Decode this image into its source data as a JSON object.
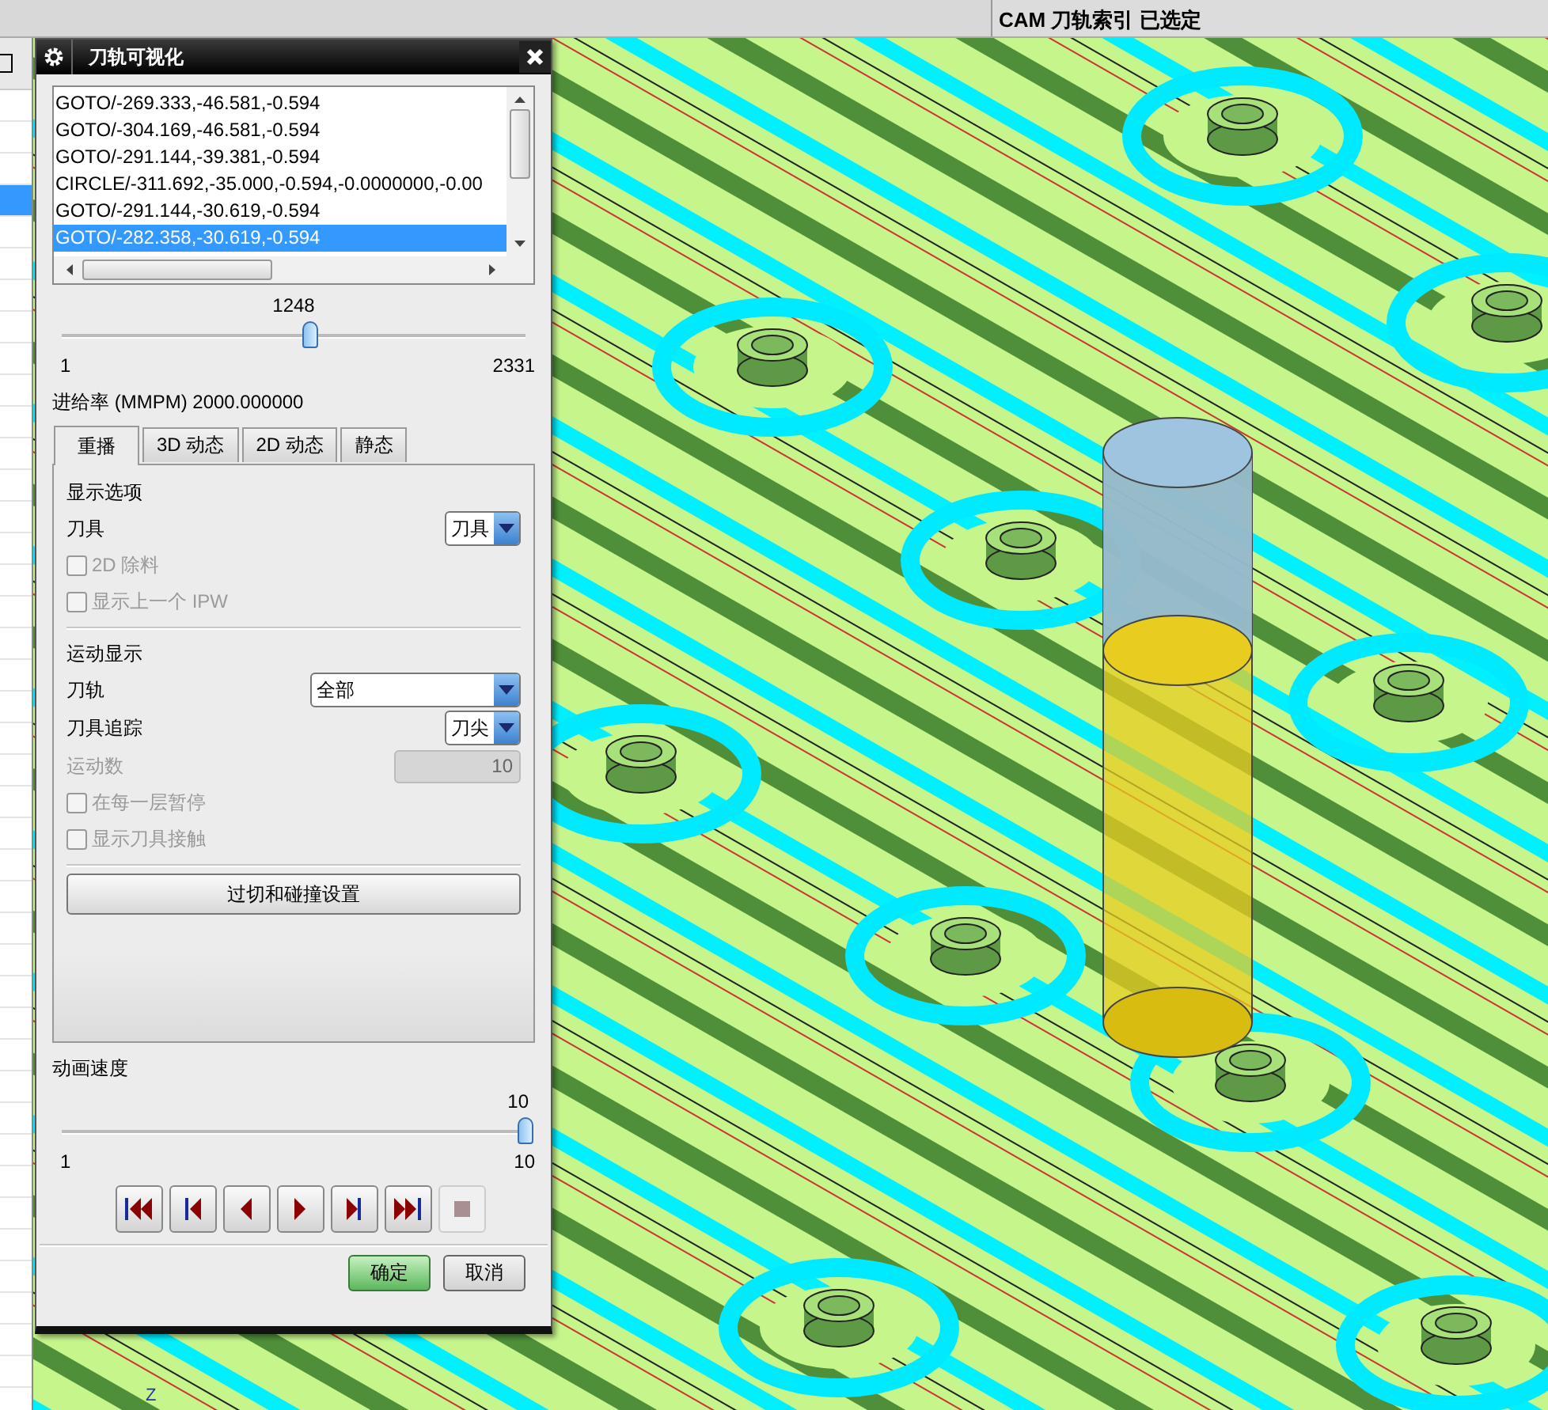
{
  "status_bar": {
    "message": "CAM 刀轨索引 已选定"
  },
  "side_list": {
    "rows": [
      {
        "selected": false
      },
      {
        "selected": false
      },
      {
        "selected": false
      },
      {
        "selected": true
      },
      {
        "selected": false
      },
      {
        "selected": false
      },
      {
        "selected": false
      },
      {
        "selected": false
      },
      {
        "selected": false
      },
      {
        "selected": false
      },
      {
        "selected": false
      },
      {
        "selected": false
      },
      {
        "selected": false
      },
      {
        "selected": false
      },
      {
        "selected": false
      },
      {
        "selected": false
      },
      {
        "selected": false
      },
      {
        "selected": false
      },
      {
        "selected": false
      },
      {
        "selected": false
      },
      {
        "selected": false
      },
      {
        "selected": false
      },
      {
        "selected": false
      },
      {
        "selected": false
      },
      {
        "selected": false
      },
      {
        "selected": false
      },
      {
        "selected": false
      },
      {
        "selected": false
      },
      {
        "selected": false
      },
      {
        "selected": false
      },
      {
        "selected": false
      },
      {
        "selected": false
      },
      {
        "selected": false
      },
      {
        "selected": false
      },
      {
        "selected": false
      },
      {
        "selected": false
      },
      {
        "selected": false
      },
      {
        "selected": false
      },
      {
        "selected": false
      },
      {
        "selected": false
      },
      {
        "selected": false
      }
    ]
  },
  "dialog": {
    "title": "刀轨可视化",
    "path_list": {
      "rows": [
        {
          "text": "GOTO/-269.333,-46.581,-0.594",
          "selected": false
        },
        {
          "text": "GOTO/-304.169,-46.581,-0.594",
          "selected": false
        },
        {
          "text": "GOTO/-291.144,-39.381,-0.594",
          "selected": false
        },
        {
          "text": "CIRCLE/-311.692,-35.000,-0.594,-0.0000000,-0.00",
          "selected": false
        },
        {
          "text": "GOTO/-291.144,-30.619,-0.594",
          "selected": false
        },
        {
          "text": "GOTO/-282.358,-30.619,-0.594",
          "selected": true
        }
      ]
    },
    "position_slider": {
      "value": "1248",
      "min": "1",
      "max": "2331",
      "level": 0.535
    },
    "feed_rate": "进给率 (MMPM) 2000.000000",
    "tabs": [
      {
        "label": "重播",
        "selected": true
      },
      {
        "label": "3D 动态",
        "selected": false
      },
      {
        "label": "2D 动态",
        "selected": false
      },
      {
        "label": "静态",
        "selected": false
      }
    ],
    "options": [
      {
        "kind": "heading",
        "label": "显示选项"
      },
      {
        "kind": "dropdown",
        "label": "刀具",
        "value": "刀具"
      },
      {
        "kind": "checkbox",
        "label": "2D 除料",
        "checked": false,
        "disabled": true
      },
      {
        "kind": "checkbox",
        "label": "显示上一个 IPW",
        "checked": false,
        "disabled": true
      },
      {
        "kind": "heading",
        "label": "运动显示"
      },
      {
        "kind": "combo",
        "label": "刀轨",
        "value": "全部"
      },
      {
        "kind": "dropdown",
        "label": "刀具追踪",
        "value": "刀尖"
      },
      {
        "kind": "number",
        "label": "运动数",
        "value": "10",
        "disabled": true
      },
      {
        "kind": "checkbox",
        "label": "在每一层暂停",
        "checked": false,
        "disabled": true
      },
      {
        "kind": "checkbox",
        "label": "显示刀具接触",
        "checked": false,
        "disabled": true
      },
      {
        "kind": "button",
        "label": "过切和碰撞设置"
      }
    ],
    "speed_slider": {
      "label": "动画速度",
      "value": "10",
      "min": "1",
      "max": "10",
      "level": 1
    },
    "playback_buttons": [
      {
        "kind": "first",
        "disabled": false
      },
      {
        "kind": "prev",
        "disabled": false
      },
      {
        "kind": "reverse",
        "disabled": false
      },
      {
        "kind": "play",
        "disabled": false
      },
      {
        "kind": "next",
        "disabled": false
      },
      {
        "kind": "last",
        "disabled": false
      },
      {
        "kind": "stop",
        "disabled": true
      }
    ],
    "buttons": [
      {
        "label": "确定",
        "default": true
      },
      {
        "label": "取消",
        "default": false
      }
    ]
  },
  "viewport": {
    "axis_label": "Z"
  }
}
